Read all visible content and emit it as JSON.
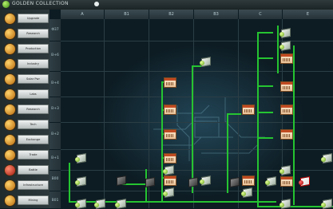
{
  "top_bar": {
    "title": "GOLDEN COLLECTION",
    "tabs": [
      "",
      "",
      ""
    ]
  },
  "sidebar": {
    "items": [
      {
        "label": "Upgrade",
        "icon": "coin-icon",
        "color": "gold"
      },
      {
        "label": "Research",
        "icon": "coin-icon",
        "color": "gold"
      },
      {
        "label": "Production",
        "icon": "coin-icon",
        "color": "gold"
      },
      {
        "label": "Industry",
        "icon": "coin-icon",
        "color": "gold"
      },
      {
        "label": "Solar Pwr",
        "icon": "coin-icon",
        "color": "gold"
      },
      {
        "label": "Labs",
        "icon": "coin-icon",
        "color": "gold"
      },
      {
        "label": "Research",
        "icon": "coin-icon",
        "color": "gold"
      },
      {
        "label": "Tech",
        "icon": "coin-icon",
        "color": "gold"
      },
      {
        "label": "Exchange",
        "icon": "coin-icon",
        "color": "gold"
      },
      {
        "label": "Trade",
        "icon": "coin-icon",
        "color": "gold"
      },
      {
        "label": "Battle",
        "icon": "coin-icon",
        "color": "red"
      },
      {
        "label": "Infrastructure",
        "icon": "coin-icon",
        "color": "gold"
      },
      {
        "label": "Mining",
        "icon": "coin-icon",
        "color": "gold"
      }
    ]
  },
  "grid": {
    "columns": [
      "A",
      "B1",
      "B2",
      "B3",
      "C",
      "E"
    ],
    "rows": [
      "Φ37",
      "B+6",
      "B+4",
      "B+3",
      "B+2",
      "B+1",
      "B00",
      "B01"
    ]
  },
  "colors": {
    "connector": "#25c431",
    "background": "#0d1c23"
  }
}
